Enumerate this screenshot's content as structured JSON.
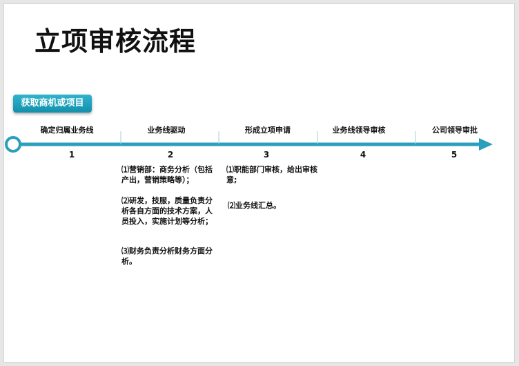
{
  "title": "立项审核流程",
  "tag": "获取商机或项目",
  "steps": [
    {
      "label": "确定归属业务线",
      "num": "1"
    },
    {
      "label": "业务线驱动",
      "num": "2"
    },
    {
      "label": "形成立项申请",
      "num": "3"
    },
    {
      "label": "业务线领导审核",
      "num": "4"
    },
    {
      "label": "公司领导审批",
      "num": "5"
    }
  ],
  "details": {
    "step2": [
      "⑴营销部：商务分析（包括产出，营销策略等）；",
      "⑵研发，技服，质量负责分析各自方面的技术方案，人员投入，实施计划等分析；",
      "⑶财务负责分析财务方面分析。"
    ],
    "step3": [
      "⑴职能部门审核，给出审核意;",
      "⑵业务线汇总。"
    ]
  },
  "colors": {
    "accent": "#2a9fbc",
    "tag": "#1a9fb9"
  }
}
